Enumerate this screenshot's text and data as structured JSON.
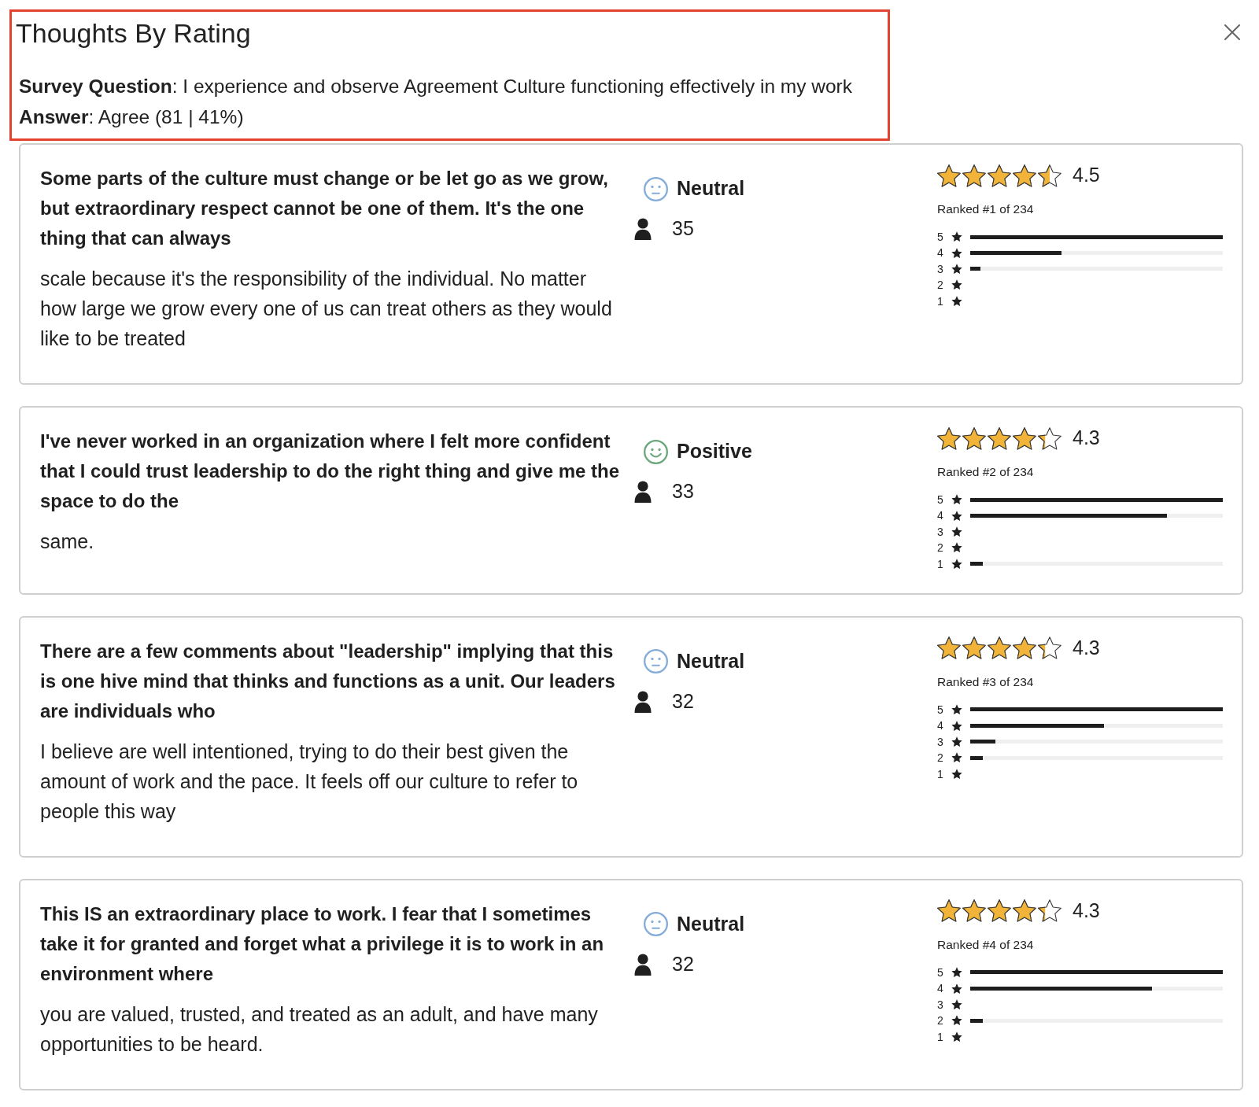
{
  "dialog": {
    "title": "Thoughts By Rating",
    "highlighted": true,
    "question": "**Survey Question**: I experience and observe Agreement Culture functioning effectively in my work",
    "answer": "**Answer**: Agree (81 | 41%)"
  },
  "comments": [
    {
      "heading": "Some parts of the culture must change or be let go as we grow, but extraordinary respect cannot be one of them. It's the one thing that can always",
      "body": "scale because it's the responsibility of the individual. No matter how large we grow every one of us can treat others as they would like to be treated",
      "sentiment": {
        "kind": "neutral",
        "label": "Neutral",
        "color": "#84acd8"
      },
      "respondents": "35",
      "stars": 4.5,
      "rating": "4.5",
      "rank": "Ranked #1 of 234",
      "distribution": [
        {
          "label": "5",
          "level": 1
        },
        {
          "label": "4",
          "level": 0.36
        },
        {
          "label": "3",
          "level": 0.04
        },
        {
          "label": "2"
        },
        {
          "label": "1"
        }
      ]
    },
    {
      "heading": "I've never worked in an organization where I felt more confident that I could trust leadership to do the right thing and give me the space to do the",
      "body": "same.",
      "sentiment": {
        "kind": "positive",
        "label": "Positive",
        "color": "#6aa77a"
      },
      "respondents": "33",
      "stars": 4.3,
      "rating": "4.3",
      "rank": "Ranked #2 of 234",
      "distribution": [
        {
          "label": "5",
          "level": 1
        },
        {
          "label": "4",
          "level": 0.78
        },
        {
          "label": "3"
        },
        {
          "label": "2"
        },
        {
          "label": "1",
          "level": 0.05
        }
      ]
    },
    {
      "heading": "There are a few comments about \"leadership\" implying that this is one hive mind that thinks and functions as a unit. Our leaders are individuals who",
      "body": "I believe are well intentioned, trying to do their best given the amount of work and the pace. It feels off our culture to refer to people this way",
      "sentiment": {
        "kind": "neutral",
        "label": "Neutral",
        "color": "#84acd8"
      },
      "respondents": "32",
      "stars": 4.3,
      "rating": "4.3",
      "rank": "Ranked #3 of 234",
      "distribution": [
        {
          "label": "5",
          "level": 1
        },
        {
          "label": "4",
          "level": 0.53
        },
        {
          "label": "3",
          "level": 0.1
        },
        {
          "label": "2",
          "level": 0.05
        },
        {
          "label": "1"
        }
      ]
    },
    {
      "heading": "This IS an extraordinary place to work. I fear that I sometimes take it for granted and forget what a privilege it is to work in an environment where",
      "body": "you are valued, trusted, and treated as an adult, and have many opportunities to be heard.",
      "sentiment": {
        "kind": "neutral",
        "label": "Neutral",
        "color": "#84acd8"
      },
      "respondents": "32",
      "stars": 4.3,
      "rating": "4.3",
      "rank": "Ranked #4 of 234",
      "distribution": [
        {
          "label": "5",
          "level": 1
        },
        {
          "label": "4",
          "level": 0.72
        },
        {
          "label": "3"
        },
        {
          "label": "2",
          "level": 0.05
        },
        {
          "label": "1"
        }
      ]
    }
  ]
}
